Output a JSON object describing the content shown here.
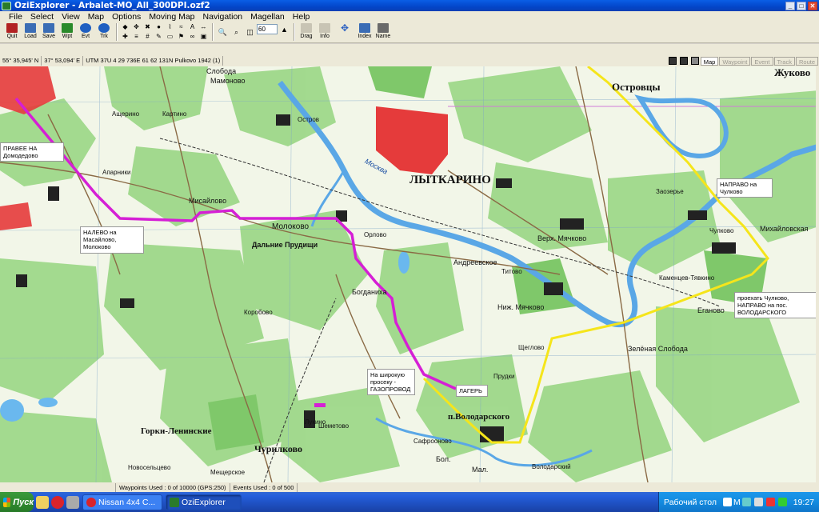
{
  "window": {
    "app": "OziExplorer",
    "title": "OziExplorer - Arbalet-MO_All_300DPI.ozf2",
    "controls": [
      "_",
      "□",
      "✕"
    ]
  },
  "menu": [
    "File",
    "Select",
    "View",
    "Map",
    "Options",
    "Moving Map",
    "Navigation",
    "Magellan",
    "Help"
  ],
  "toolbar": {
    "buttons": [
      {
        "label": "Quit",
        "icon": "quit-icon",
        "color": "#b22222"
      },
      {
        "label": "Load",
        "icon": "load-icon",
        "color": "#3b6db5"
      },
      {
        "label": "Save",
        "icon": "save-icon",
        "color": "#3b6db5"
      },
      {
        "label": "Wpt",
        "icon": "waypoint-icon",
        "color": "#2a8a2a"
      },
      {
        "label": "Evt",
        "icon": "event-icon",
        "color": "#1f5fc1"
      },
      {
        "label": "Trk",
        "icon": "track-icon",
        "color": "#1f5fc1"
      }
    ],
    "zoom_value": "60",
    "right_buttons": [
      {
        "label": "Drag",
        "icon": "drag-icon"
      },
      {
        "label": "Info",
        "icon": "info-icon"
      },
      {
        "label": "",
        "icon": "pan-arrows-icon"
      },
      {
        "label": "Index",
        "icon": "index-icon"
      },
      {
        "label": "Name",
        "icon": "name-icon"
      }
    ]
  },
  "coordinates": {
    "lat": "55° 35,945' N",
    "lon": "37° 53,094' E",
    "utm": "UTM  37U    4 29 736E    61 62 131N  Pulkovo 1942 (1)"
  },
  "mode_tabs": [
    "Map",
    "Waypoint",
    "Event",
    "Track",
    "Route"
  ],
  "active_mode": "Map",
  "map": {
    "places": [
      {
        "name": "ЛЫТКАРИНО",
        "big": true
      },
      {
        "name": "Островцы",
        "big": true
      },
      {
        "name": "Жуково",
        "big": true
      },
      {
        "name": "Молоково",
        "big": false
      },
      {
        "name": "Дальние Прудищи",
        "big": false
      },
      {
        "name": "Андреевское",
        "big": false
      },
      {
        "name": "Верх. Мячково",
        "big": false
      },
      {
        "name": "Ниж. Мячково",
        "big": false
      },
      {
        "name": "Чурилково",
        "big": true
      },
      {
        "name": "Горки-Ленинские",
        "big": true
      },
      {
        "name": "Богданиха",
        "big": false
      },
      {
        "name": "Мисайлово",
        "big": false
      },
      {
        "name": "Слобода",
        "big": false
      },
      {
        "name": "Мамоново",
        "big": false
      },
      {
        "name": "Остров",
        "big": false
      },
      {
        "name": "Картино",
        "big": false
      },
      {
        "name": "Апарники",
        "big": false
      },
      {
        "name": "Ащерино",
        "big": false
      },
      {
        "name": "Коробово",
        "big": false
      },
      {
        "name": "Лукино",
        "big": false
      },
      {
        "name": "Еганово",
        "big": false
      },
      {
        "name": "Чулково",
        "big": false
      },
      {
        "name": "Михайловская",
        "big": false
      },
      {
        "name": "Зелёная Слобода",
        "big": false
      },
      {
        "name": "Титово",
        "big": false
      },
      {
        "name": "Прудки",
        "big": false
      },
      {
        "name": "Щеглово",
        "big": false
      },
      {
        "name": "Шеметово",
        "big": false
      },
      {
        "name": "Новосельцево",
        "big": false
      },
      {
        "name": "Мещерское",
        "big": false
      },
      {
        "name": "Орлово",
        "big": false
      },
      {
        "name": "Сафрооново",
        "big": false
      },
      {
        "name": "Бол.",
        "big": false
      },
      {
        "name": "Мал.",
        "big": false
      },
      {
        "name": "Володарский",
        "big": false
      },
      {
        "name": "п.Володарского",
        "big": true
      },
      {
        "name": "Каменцев-Тявкино",
        "big": false
      },
      {
        "name": "Заозерье",
        "big": false
      }
    ],
    "river_label": "Москва",
    "notes": [
      {
        "id": "right-domodedovo",
        "text": "ПРАВЕЕ НА\nДомодедово"
      },
      {
        "id": "left-misailovo",
        "text": "НАЛЕВО на\nМасайлово,\nМолоково"
      },
      {
        "id": "right-chulkovo",
        "text": "НАПРАВО на\nЧулково"
      },
      {
        "id": "pass-chulkovo",
        "text": "проехать Чулково,\nНАПРАВО на пос.\nВОЛОДАРСКОГО"
      },
      {
        "id": "wide-prosek",
        "text": "На широкую\nпросеку -\nГАЗОПРОВОД"
      },
      {
        "id": "camp",
        "text": "ЛАГЕРЬ"
      }
    ],
    "route_colors": {
      "magenta": "#d51fd5",
      "yellow": "#f5e51b"
    }
  },
  "status": {
    "waypoints": "Waypoints Used : 0 of 10000  (GPS:250)",
    "events": "Events Used : 0 of 500"
  },
  "taskbar": {
    "start": "Пуск",
    "tasks": [
      {
        "label": "Nissan 4x4 C...",
        "icon": "opera-icon",
        "active": false
      },
      {
        "label": "OziExplorer",
        "icon": "ozi-icon",
        "active": true
      }
    ],
    "desktop": "Рабочий стол",
    "clock": "19:27",
    "tray_extra": "M"
  }
}
